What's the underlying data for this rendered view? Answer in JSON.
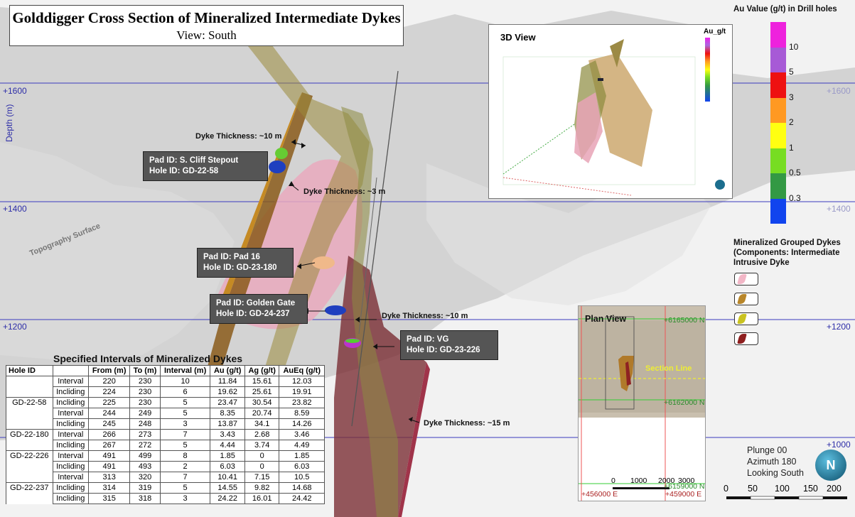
{
  "title": {
    "main": "Golddigger Cross Section of Mineralized Intermediate Dykes",
    "sub": "View: South"
  },
  "elevations": {
    "e1600": "+1600",
    "e1400": "+1400",
    "e1200": "+1200",
    "e1000": "+1000"
  },
  "depth_label": "Depth (m)",
  "topography_label": "Topography Surface",
  "dyke_thickness": {
    "t1": "Dyke Thickness: ~10 m",
    "t2": "Dyke Thickness: ~3 m",
    "t3": "Dyke Thickness: ~10 m",
    "t4": "Dyke Thickness: ~15 m"
  },
  "callouts": {
    "c1": {
      "pad": "Pad ID: S. Cliff Stepout",
      "hole": "Hole ID: GD-22-58"
    },
    "c2": {
      "pad": "Pad ID: Pad 16",
      "hole": "Hole ID: GD-23-180"
    },
    "c3": {
      "pad": "Pad ID: Golden Gate",
      "hole": "Hole ID: GD-24-237"
    },
    "c4": {
      "pad": "Pad ID: VG",
      "hole": "Hole ID: GD-23-226"
    }
  },
  "inset_3d": {
    "title": "3D View",
    "legend_title": "Au_g/t"
  },
  "plan_view": {
    "title": "Plan View",
    "section_line": "Section Line",
    "n1": "+6165000 N",
    "n2": "+6162000 N",
    "n3": "+6159000 N",
    "e1": "+456000 E",
    "e2": "+459000 E",
    "scale": [
      "0",
      "1000",
      "2000",
      "3000"
    ]
  },
  "au_legend": {
    "title": "Au Value (g/t) in Drill holes",
    "labels": [
      "10",
      "5",
      "3",
      "2",
      "1",
      "0.5",
      "0.3"
    ],
    "colors": [
      "#ee22dd",
      "#a75ad6",
      "#ee1111",
      "#ff9922",
      "#ffff11",
      "#77dd22",
      "#339944",
      "#1144ee"
    ]
  },
  "dyke_legend": {
    "title": [
      "Mineralized Grouped Dykes",
      "(Components: Intermediate",
      "Intrusive Dyke"
    ],
    "colors": [
      "#f2b6c6",
      "#b8862a",
      "#c9c220",
      "#8e1f1f"
    ]
  },
  "orientation": {
    "plunge": "Plunge 00",
    "azimuth": "Azimuth 180",
    "looking": "Looking South",
    "north": "N"
  },
  "scale_bar": [
    "0",
    "50",
    "100",
    "150",
    "200"
  ],
  "table": {
    "title": "Specified Intervals of Mineralized Dykes",
    "headers": [
      "Hole ID",
      "",
      "From (m)",
      "To (m)",
      "Interval (m)",
      "Au (g/t)",
      "Ag (g/t)",
      "AuEq (g/t)"
    ],
    "rows": [
      {
        "hole": "",
        "type": "Interval",
        "from": "220",
        "to": "230",
        "int": "10",
        "au": "11.84",
        "ag": "15.61",
        "aueq": "12.03"
      },
      {
        "hole": "",
        "type": "Incliding",
        "from": "224",
        "to": "230",
        "int": "6",
        "au": "19.62",
        "ag": "25.61",
        "aueq": "19.91"
      },
      {
        "hole": "GD-22-58",
        "type": "Incliding",
        "from": "225",
        "to": "230",
        "int": "5",
        "au": "23.47",
        "ag": "30.54",
        "aueq": "23.82"
      },
      {
        "hole": "",
        "type": "Interval",
        "from": "244",
        "to": "249",
        "int": "5",
        "au": "8.35",
        "ag": "20.74",
        "aueq": "8.59"
      },
      {
        "hole": "",
        "type": "Incliding",
        "from": "245",
        "to": "248",
        "int": "3",
        "au": "13.87",
        "ag": "34.1",
        "aueq": "14.26"
      },
      {
        "hole": "GD-22-180",
        "type": "Interval",
        "from": "266",
        "to": "273",
        "int": "7",
        "au": "3.43",
        "ag": "2.68",
        "aueq": "3.46"
      },
      {
        "hole": "",
        "type": "Incliding",
        "from": "267",
        "to": "272",
        "int": "5",
        "au": "4.44",
        "ag": "3.74",
        "aueq": "4.49"
      },
      {
        "hole": "GD-22-226",
        "type": "Interval",
        "from": "491",
        "to": "499",
        "int": "8",
        "au": "1.85",
        "ag": "0",
        "aueq": "1.85"
      },
      {
        "hole": "",
        "type": "Incliding",
        "from": "491",
        "to": "493",
        "int": "2",
        "au": "6.03",
        "ag": "0",
        "aueq": "6.03"
      },
      {
        "hole": "",
        "type": "Interval",
        "from": "313",
        "to": "320",
        "int": "7",
        "au": "10.41",
        "ag": "7.15",
        "aueq": "10.5"
      },
      {
        "hole": "GD-22-237",
        "type": "Incliding",
        "from": "314",
        "to": "319",
        "int": "5",
        "au": "14.55",
        "ag": "9.82",
        "aueq": "14.68"
      },
      {
        "hole": "",
        "type": "Incliding",
        "from": "315",
        "to": "318",
        "int": "3",
        "au": "24.22",
        "ag": "16.01",
        "aueq": "24.42"
      }
    ]
  }
}
